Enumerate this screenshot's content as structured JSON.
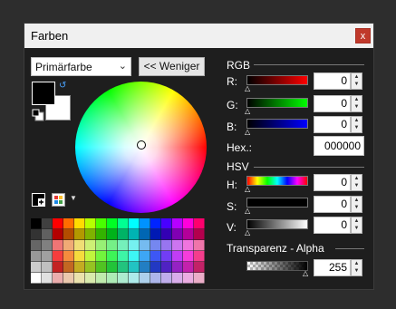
{
  "window": {
    "title": "Farben",
    "close_glyph": "x"
  },
  "primary_selector": {
    "value": "Primärfarbe"
  },
  "less_button": {
    "label": "<< Weniger"
  },
  "rgb": {
    "section": "RGB",
    "channels": [
      {
        "label": "R:",
        "value": "0"
      },
      {
        "label": "G:",
        "value": "0"
      },
      {
        "label": "B:",
        "value": "0"
      }
    ],
    "hex_label": "Hex.:",
    "hex_value": "000000"
  },
  "hsv": {
    "section": "HSV",
    "channels": [
      {
        "label": "H:",
        "value": "0"
      },
      {
        "label": "S:",
        "value": "0"
      },
      {
        "label": "V:",
        "value": "0"
      }
    ]
  },
  "alpha": {
    "section": "Transparenz - Alpha",
    "value": "255"
  },
  "colors": {
    "primary": "#000000",
    "secondary": "#ffffff",
    "close_button": "#c0392b"
  },
  "icons": [
    "swap-colors-icon",
    "reset-colors-icon",
    "add-palette-color-icon",
    "palette-menu-icon",
    "dropdown-arrow-icon"
  ]
}
